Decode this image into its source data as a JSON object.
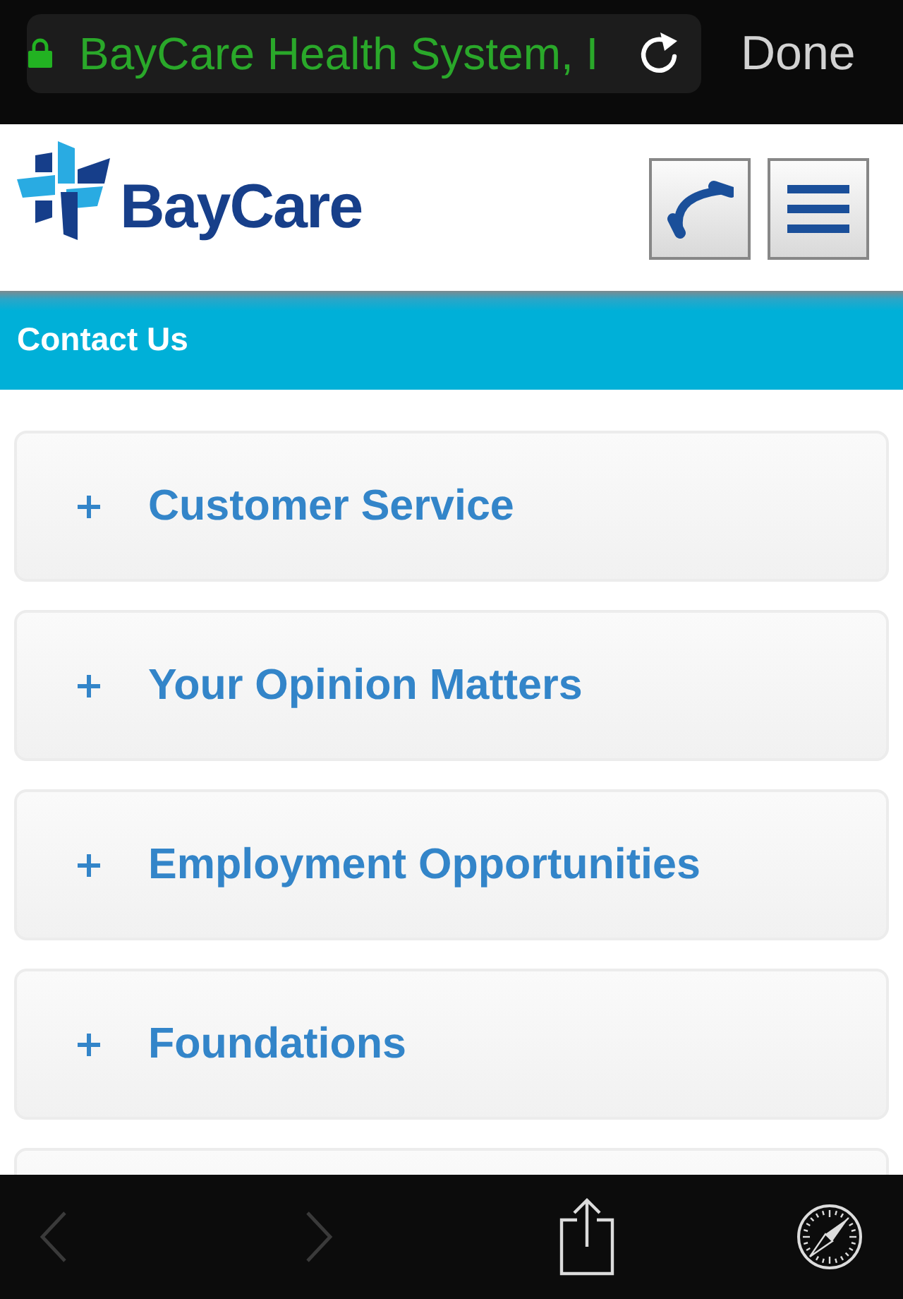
{
  "browser_bar": {
    "secure": true,
    "address": "BayCare Health System, I",
    "done_label": "Done"
  },
  "header": {
    "logo_text": "BayCare"
  },
  "page_title": "Contact Us",
  "accordion": {
    "items": [
      {
        "title": "Customer Service",
        "expanded": false
      },
      {
        "title": "Your Opinion Matters",
        "expanded": false
      },
      {
        "title": "Employment Opportunities",
        "expanded": false
      },
      {
        "title": "Foundations",
        "expanded": false
      }
    ],
    "more_below": true
  },
  "toolbar": {
    "back": {
      "disabled": true
    },
    "forward": {
      "disabled": true
    }
  }
}
